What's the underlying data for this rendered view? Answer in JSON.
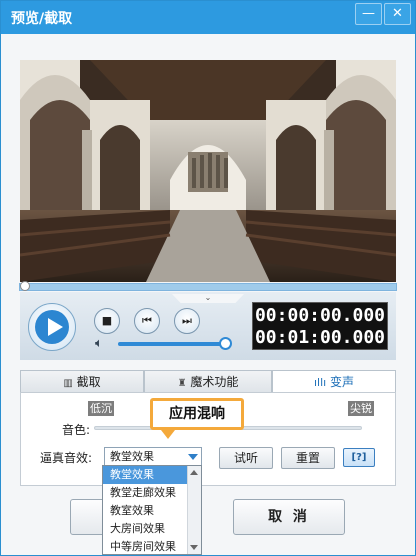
{
  "window": {
    "title": "预览/截取",
    "min_label": "—",
    "close_label": "✕"
  },
  "player": {
    "collapse_glyph": "⌄",
    "stop_glyph": "■",
    "prev_glyph": "⏮",
    "next_glyph": "⏭",
    "time_current": "00:00:00.000",
    "time_total": "00:01:00.000",
    "volume": 1.0,
    "progress": 0.0
  },
  "tabs": [
    {
      "label": "截取",
      "icon": "crop-icon"
    },
    {
      "label": "魔术功能",
      "icon": "magic-hat-icon"
    },
    {
      "label": "变声",
      "icon": "voice-wave-icon"
    }
  ],
  "voice_panel": {
    "low_label": "低沉",
    "high_label": "尖锐",
    "pitch_label": "音色:",
    "callout": "应用混响",
    "effect_label": "逼真音效:",
    "selected_effect": "教堂效果",
    "listen_button": "试听",
    "reset_button": "重置",
    "help_label": "[?]",
    "effect_options": [
      "教堂效果",
      "教堂走廊效果",
      "教室效果",
      "大房间效果",
      "中等房间效果"
    ]
  },
  "footer": {
    "ok_button": "",
    "cancel_button": "取 消"
  }
}
